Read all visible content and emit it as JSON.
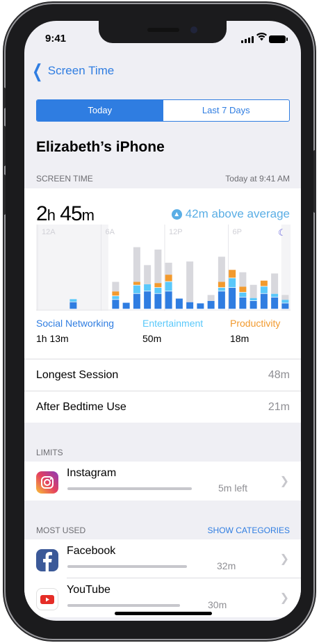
{
  "status": {
    "time": "9:41"
  },
  "nav": {
    "back_label": "Screen Time"
  },
  "segment": {
    "today": "Today",
    "last7": "Last 7 Days",
    "selected": "Today"
  },
  "device_name": "Elizabeth’s iPhone",
  "screen_time_section": {
    "title": "SCREEN TIME",
    "timestamp": "Today at 9:41 AM",
    "total_hours": "2",
    "total_hours_unit": "h",
    "total_minutes": "45",
    "total_minutes_unit": "m",
    "average": "42m above average",
    "axis_labels": [
      "12A",
      "6A",
      "12P",
      "6P"
    ],
    "categories": [
      {
        "name": "Social Networking",
        "value": "1h 13m",
        "color": "#2f7de1"
      },
      {
        "name": "Entertainment",
        "value": "50m",
        "color": "#5ac8fa"
      },
      {
        "name": "Productivity",
        "value": "18m",
        "color": "#f29a2e"
      }
    ]
  },
  "stats": [
    {
      "label": "Longest Session",
      "value": "48m"
    },
    {
      "label": "After Bedtime Use",
      "value": "21m"
    }
  ],
  "limits": {
    "title": "LIMITS",
    "items": [
      {
        "name": "Instagram",
        "amount": "5m left",
        "usage_fraction": 0.85
      }
    ]
  },
  "most_used": {
    "title": "MOST USED",
    "action": "SHOW CATEGORIES",
    "items": [
      {
        "name": "Facebook",
        "amount": "32m",
        "usage_fraction": 0.82
      },
      {
        "name": "YouTube",
        "amount": "30m",
        "usage_fraction": 0.77
      }
    ]
  },
  "chart_data": {
    "type": "bar",
    "stacked": true,
    "x_tick_labels": [
      "12A",
      "6A",
      "12P",
      "6P"
    ],
    "bars": 24,
    "series": [
      {
        "name": "Social Networking",
        "values": [
          0,
          0,
          0,
          1.2,
          0,
          0,
          0,
          1.6,
          1.1,
          2.6,
          3.0,
          2.6,
          3.0,
          1.8,
          1.2,
          1.0,
          1.4,
          3.0,
          3.6,
          2.0,
          1.4,
          2.6,
          2.0,
          1.0
        ]
      },
      {
        "name": "Entertainment",
        "values": [
          0,
          0,
          0,
          0.5,
          0,
          0,
          0,
          0.6,
          0,
          1.4,
          1.2,
          1.0,
          1.6,
          0,
          0,
          0,
          0,
          0.6,
          1.6,
          0.8,
          0.5,
          1.2,
          0.6,
          0.6
        ]
      },
      {
        "name": "Productivity",
        "values": [
          0,
          0,
          0,
          0,
          0,
          0,
          0,
          0.8,
          0,
          0.6,
          0,
          0.8,
          1.2,
          0,
          0,
          0,
          0,
          1.0,
          1.4,
          1.0,
          0,
          1.0,
          0,
          0
        ]
      },
      {
        "name": "Other",
        "values": [
          0,
          0,
          0,
          0,
          0,
          0,
          0,
          1.6,
          0,
          5.8,
          3.2,
          5.6,
          2.0,
          0,
          6.8,
          0,
          1.0,
          4.2,
          0,
          2.4,
          2.2,
          0,
          3.4,
          0.8
        ]
      }
    ]
  }
}
